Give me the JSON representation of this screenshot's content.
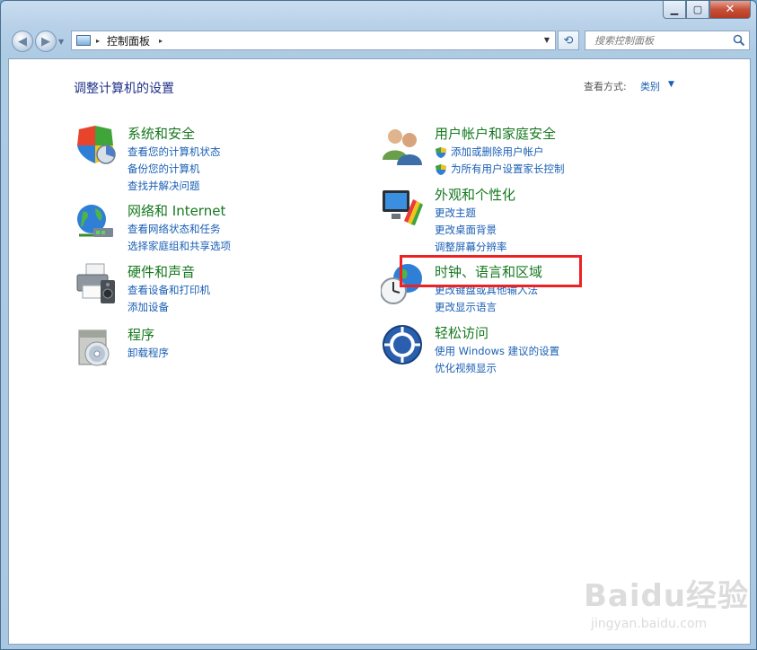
{
  "window": {
    "caption_min": "▁",
    "caption_max": "▢",
    "caption_close": "✕"
  },
  "nav": {
    "back_glyph": "◀",
    "forward_glyph": "▶",
    "dropdown_glyph": "▼",
    "address_separator": "▸",
    "address_text": "控制面板",
    "address_trailing": "▸",
    "address_dropdown": "▼",
    "refresh_glyph": "⟲",
    "search_placeholder": "搜索控制面板"
  },
  "header": {
    "title": "调整计算机的设置",
    "view_by_label": "查看方式:",
    "view_by_value": "类别",
    "view_by_caret": "▼"
  },
  "categories": [
    {
      "id": "system-security",
      "title": "系统和安全",
      "icon": "security-shield-icon",
      "links": [
        "查看您的计算机状态",
        "备份您的计算机",
        "查找并解决问题"
      ]
    },
    {
      "id": "network-internet",
      "title": "网络和 Internet",
      "icon": "network-globe-icon",
      "links": [
        "查看网络状态和任务",
        "选择家庭组和共享选项"
      ]
    },
    {
      "id": "hardware-sound",
      "title": "硬件和声音",
      "icon": "printer-speaker-icon",
      "links": [
        "查看设备和打印机",
        "添加设备"
      ]
    },
    {
      "id": "programs",
      "title": "程序",
      "icon": "programs-disc-icon",
      "links": [
        "卸载程序"
      ]
    },
    {
      "id": "user-accounts",
      "title": "用户帐户和家庭安全",
      "icon": "users-icon",
      "links": [
        "添加或删除用户帐户",
        "为所有用户设置家长控制"
      ],
      "link_shields": true
    },
    {
      "id": "appearance",
      "title": "外观和个性化",
      "icon": "monitor-palette-icon",
      "links": [
        "更改主题",
        "更改桌面背景",
        "调整屏幕分辨率"
      ]
    },
    {
      "id": "clock-language-region",
      "title": "时钟、语言和区域",
      "icon": "clock-globe-icon",
      "links": [
        "更改键盘或其他输入法",
        "更改显示语言"
      ]
    },
    {
      "id": "ease-of-access",
      "title": "轻松访问",
      "icon": "ease-of-access-icon",
      "links": [
        "使用 Windows 建议的设置",
        "优化视频显示"
      ]
    }
  ],
  "watermark": {
    "main": "Baidu经验",
    "sub": "jingyan.baidu.com"
  },
  "colors": {
    "category_title": "#15781e",
    "link": "#1a5fb4",
    "title": "#1e3287",
    "highlight": "#ee2222"
  }
}
